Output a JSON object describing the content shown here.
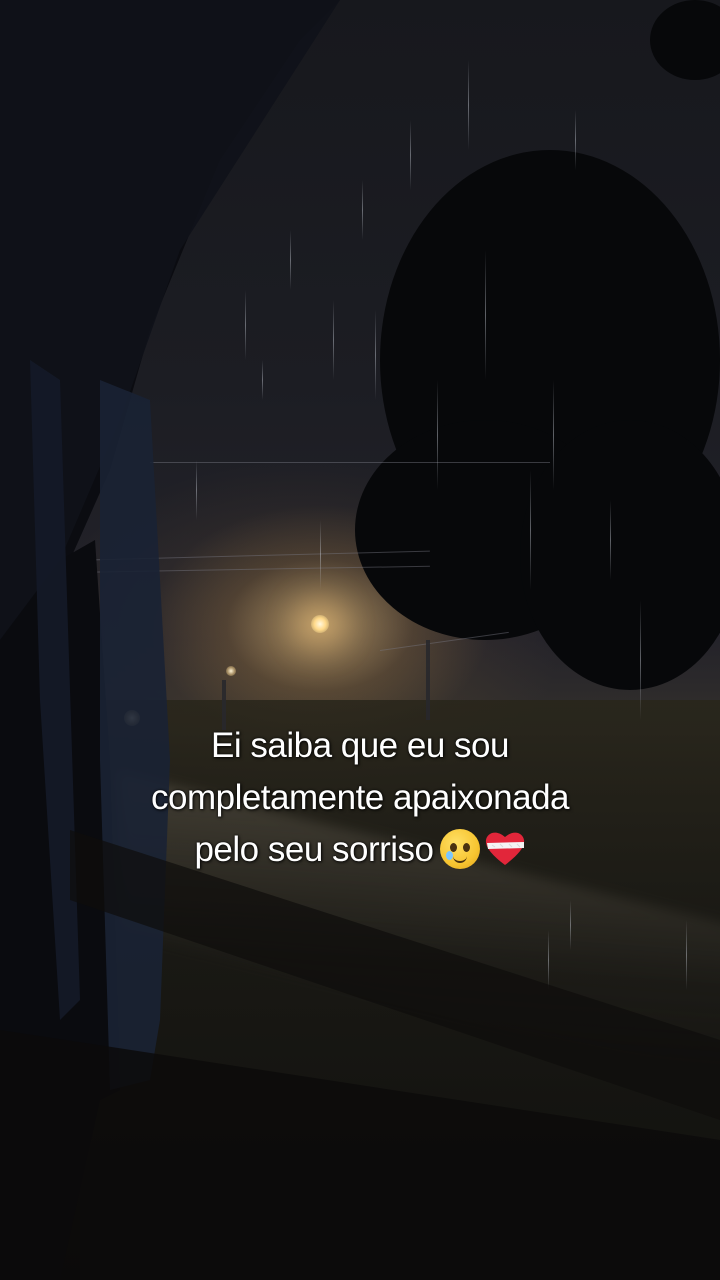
{
  "caption": {
    "line1": "Ei saiba que eu sou",
    "line2": "completamente apaixonada",
    "line3": "pelo seu sorriso"
  },
  "emojis": [
    "smiling-face-with-tear-icon",
    "mending-heart-icon"
  ]
}
